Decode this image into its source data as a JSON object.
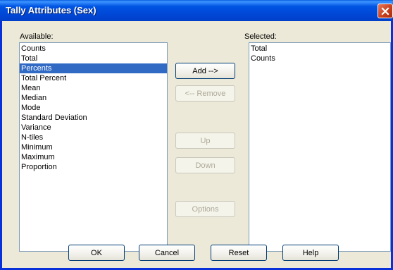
{
  "window": {
    "title": "Tally Attributes (Sex)"
  },
  "available": {
    "label": "Available:",
    "items": [
      "Counts",
      "Total",
      "Percents",
      "Total Percent",
      "Mean",
      "Median",
      "Mode",
      "Standard Deviation",
      "Variance",
      "N-tiles",
      "Minimum",
      "Maximum",
      "Proportion"
    ],
    "selected_item": "Percents"
  },
  "selected": {
    "label": "Selected:",
    "items": [
      "Total",
      "Counts"
    ]
  },
  "buttons": {
    "add": "Add -->",
    "remove": "<-- Remove",
    "up": "Up",
    "down": "Down",
    "options": "Options",
    "ok": "OK",
    "cancel": "Cancel",
    "reset": "Reset",
    "help": "Help"
  },
  "colors": {
    "title_bar": "#0054e3",
    "selection": "#316ac5",
    "dialog_bg": "#ece9d8"
  }
}
